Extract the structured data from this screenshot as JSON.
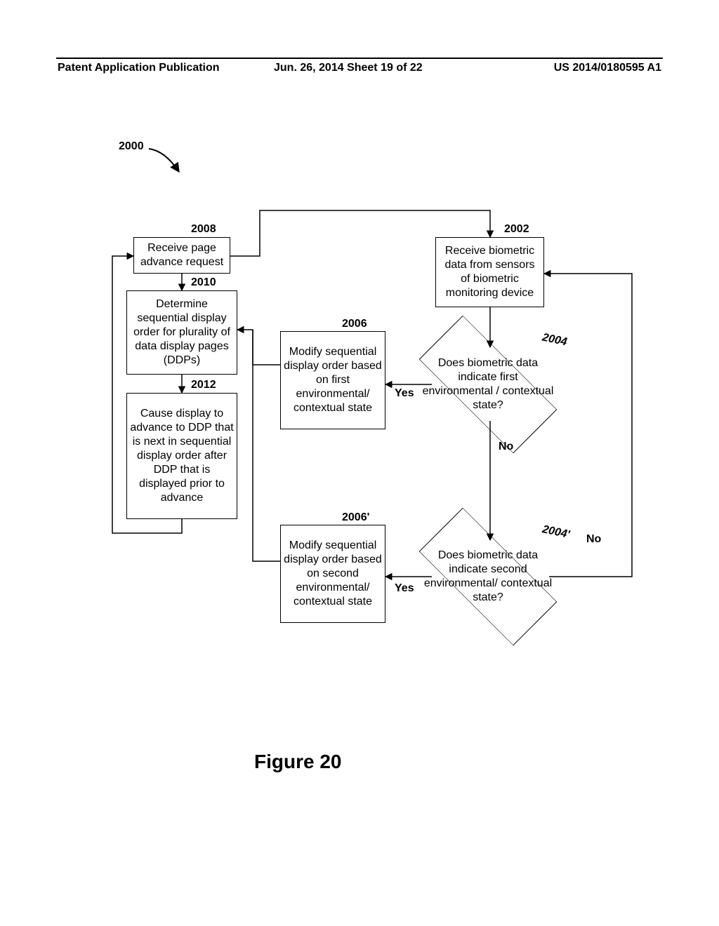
{
  "header": {
    "left": "Patent Application Publication",
    "center": "Jun. 26, 2014  Sheet 19 of 22",
    "right": "US 2014/0180595 A1"
  },
  "flow_ref": "2000",
  "labels": {
    "n2008": "2008",
    "n2010": "2010",
    "n2012": "2012",
    "n2006": "2006",
    "n2006p": "2006'",
    "n2002": "2002",
    "n2004": "2004",
    "n2004p": "2004'"
  },
  "boxes": {
    "b2008": "Receive page advance request",
    "b2010": "Determine sequential display order for plurality of data display pages (DDPs)",
    "b2012": "Cause display to advance to DDP that is next in sequential display order after DDP that is displayed prior to advance",
    "b2006": "Modify sequential display order based on first environmental/ contextual state",
    "b2006p": "Modify sequential display order based on second environmental/ contextual state",
    "b2002": "Receive biometric data from sensors of biometric monitoring device"
  },
  "diamonds": {
    "d2004": "Does biometric data indicate first environmental / contextual state?",
    "d2004p": "Does biometric data indicate second environmental/ contextual state?"
  },
  "edges": {
    "yes": "Yes",
    "no": "No"
  },
  "figure_caption": "Figure 20"
}
